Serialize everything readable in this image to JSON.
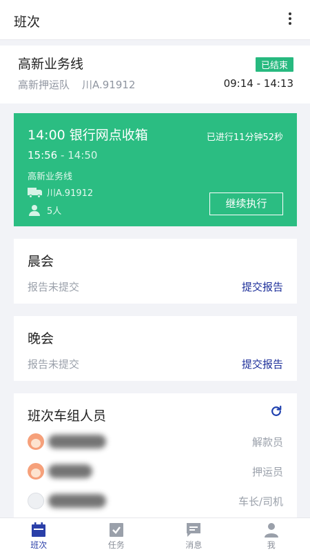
{
  "header": {
    "title": "班次"
  },
  "route": {
    "name": "高新业务线",
    "team": "高新押运队",
    "plate": "川A.91912",
    "status": "已结束",
    "time_range": "09:14 - 14:13"
  },
  "current_task": {
    "title": "14:00 银行网点收箱",
    "elapsed": "已进行11分钟52秒",
    "start": "15:56",
    "separator": " - ",
    "end": "14:50",
    "line": "高新业务线",
    "plate": "川A.91912",
    "people": "5人",
    "action_label": "继续执行"
  },
  "meetings": [
    {
      "title": "晨会",
      "status": "报告未提交",
      "action": "提交报告"
    },
    {
      "title": "晚会",
      "status": "报告未提交",
      "action": "提交报告"
    }
  ],
  "crew": {
    "title": "班次车组人员",
    "members": [
      {
        "role": "解款员"
      },
      {
        "role": "押运员"
      },
      {
        "role": "车长/司机"
      }
    ]
  },
  "bottom_nav": {
    "items": [
      {
        "label": "班次",
        "icon": "calendar-icon"
      },
      {
        "label": "任务",
        "icon": "checkbox-icon"
      },
      {
        "label": "消息",
        "icon": "message-icon"
      },
      {
        "label": "我",
        "icon": "user-icon"
      }
    ],
    "active_index": 0
  },
  "colors": {
    "accent_green": "#2bbd82",
    "link_blue": "#1d2f9a",
    "nav_active": "#2a3fa8"
  }
}
